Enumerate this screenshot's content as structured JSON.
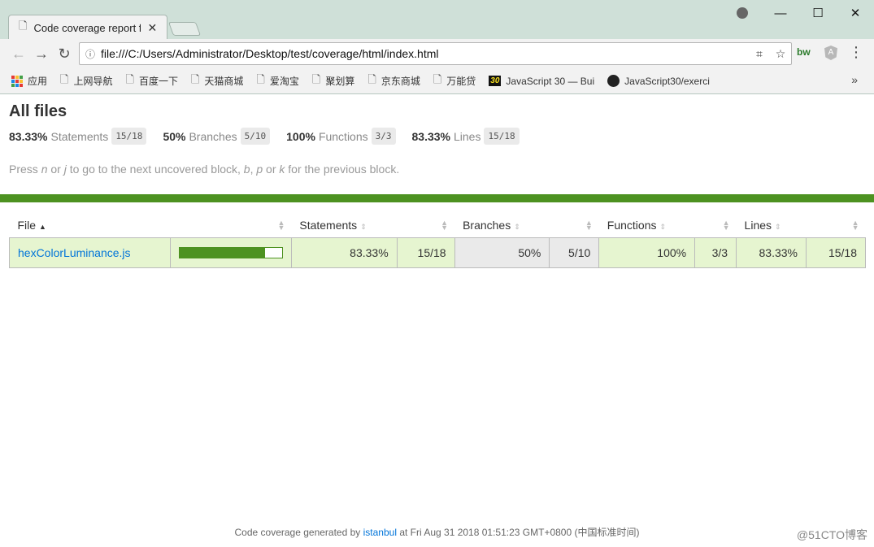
{
  "browser": {
    "tab_title": "Code coverage report f",
    "url": "file:///C:/Users/Administrator/Desktop/test/coverage/html/index.html",
    "bookmarks": [
      {
        "label": "应用",
        "icon": "apps-icon"
      },
      {
        "label": "上网导航",
        "icon": "page-icon"
      },
      {
        "label": "百度一下",
        "icon": "page-icon"
      },
      {
        "label": "天猫商城",
        "icon": "page-icon"
      },
      {
        "label": "爱淘宝",
        "icon": "page-icon"
      },
      {
        "label": "聚划算",
        "icon": "page-icon"
      },
      {
        "label": "京东商城",
        "icon": "page-icon"
      },
      {
        "label": "万能贷",
        "icon": "page-icon"
      },
      {
        "label": "JavaScript 30 — Bui",
        "icon": "js30-icon"
      },
      {
        "label": "JavaScript30/exerci",
        "icon": "github-icon"
      }
    ],
    "more_bookmarks": "»",
    "ext_bw": "bw"
  },
  "report": {
    "title": "All files",
    "summary": [
      {
        "pct": "83.33%",
        "label": "Statements",
        "fraction": "15/18"
      },
      {
        "pct": "50%",
        "label": "Branches",
        "fraction": "5/10"
      },
      {
        "pct": "100%",
        "label": "Functions",
        "fraction": "3/3"
      },
      {
        "pct": "83.33%",
        "label": "Lines",
        "fraction": "15/18"
      }
    ],
    "hint": {
      "prefix": "Press ",
      "k1": "n",
      "or1": " or ",
      "k2": "j",
      "mid": " to go to the next uncovered block, ",
      "k3": "b",
      "sep": ", ",
      "k4": "p",
      "or2": " or ",
      "k5": "k",
      "suffix": " for the previous block."
    },
    "columns": {
      "file": "File",
      "statements": "Statements",
      "branches": "Branches",
      "functions": "Functions",
      "lines": "Lines"
    },
    "rows": [
      {
        "file": "hexColorLuminance.js",
        "coverage": 0.8333,
        "statements_pct": "83.33%",
        "statements_frac": "15/18",
        "branches_pct": "50%",
        "branches_frac": "5/10",
        "functions_pct": "100%",
        "functions_frac": "3/3",
        "lines_pct": "83.33%",
        "lines_frac": "15/18"
      }
    ],
    "footer": {
      "prefix": "Code coverage generated by ",
      "link": "istanbul",
      "suffix": " at Fri Aug 31 2018 01:51:23 GMT+0800 (中国标准时间)"
    },
    "watermark": "@51CTO博客"
  },
  "colors": {
    "accent_green": "#4d9221",
    "link_blue": "#0074d9",
    "chrome_bg": "#cfe0d8"
  }
}
